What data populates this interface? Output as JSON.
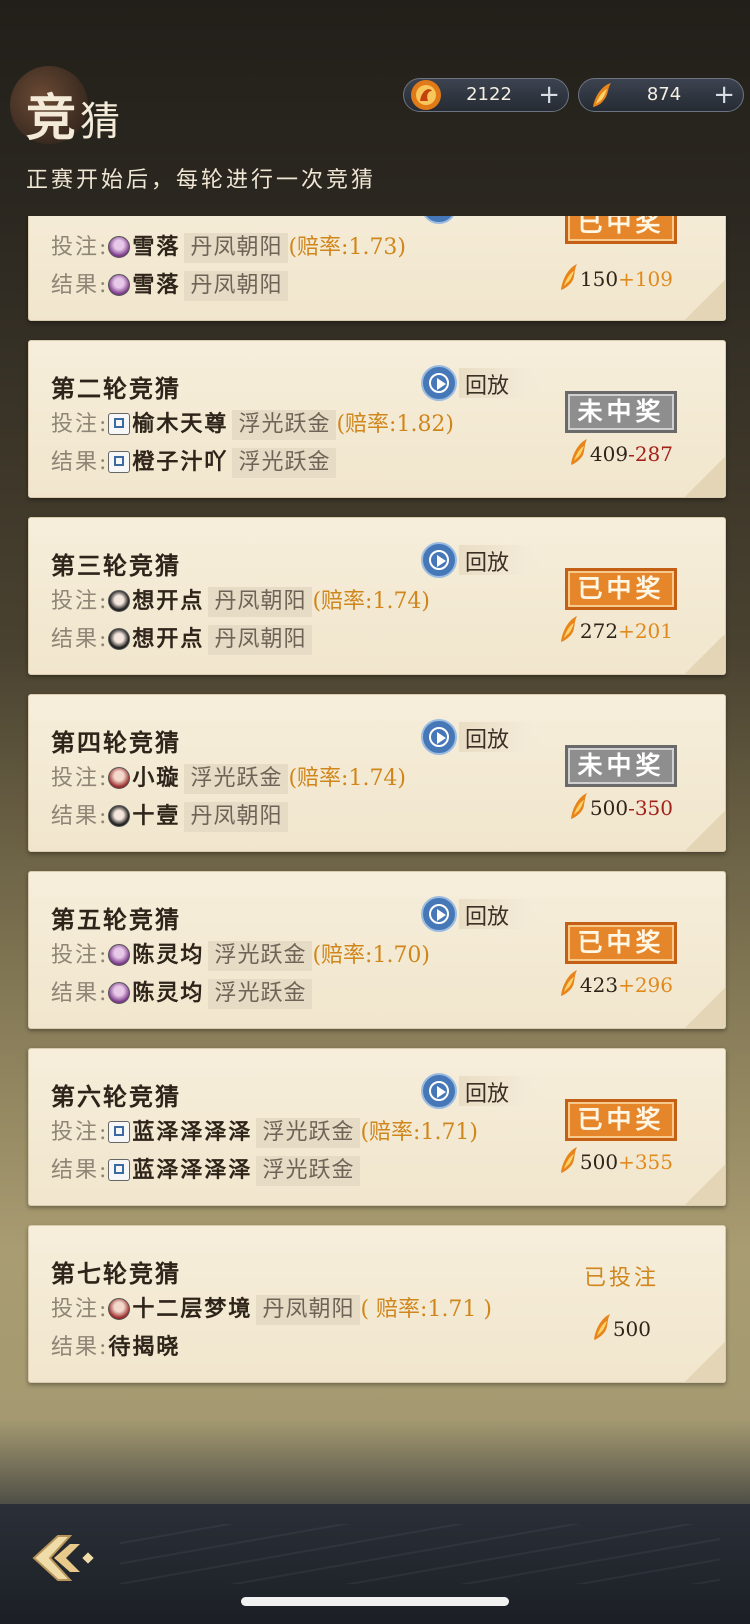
{
  "header": {
    "title_main": "竞",
    "title_second": "猜",
    "subtitle": "正赛开始后，每轮进行一次竞猜"
  },
  "currencies": [
    {
      "icon": "fire-phoenix-icon",
      "value": "2122",
      "plus": "+"
    },
    {
      "icon": "flame-feather-icon",
      "value": "874",
      "plus": "+"
    }
  ],
  "labels": {
    "bet": "投注:",
    "result": "结果:",
    "replay": "回放"
  },
  "rounds": [
    {
      "title": "",
      "bet_avatar": "purple",
      "bet_name": "雪落",
      "bet_team": "丹凤朝阳",
      "odds": "(赔率:1.73)",
      "result_avatar": "purple",
      "result_name": "雪落",
      "result_team": "丹凤朝阳",
      "status": "已中奖",
      "stake": "150",
      "delta": "+109",
      "win": true
    },
    {
      "title": "第二轮竞猜",
      "bet_avatar": "mahjong",
      "bet_name": "榆木天尊",
      "bet_team": "浮光跃金",
      "odds": "(赔率:1.82)",
      "result_avatar": "mahjong",
      "result_name": "橙子汁吖",
      "result_team": "浮光跃金",
      "status": "未中奖",
      "stake": "409",
      "delta": "-287",
      "win": false
    },
    {
      "title": "第三轮竞猜",
      "bet_avatar": "dark",
      "bet_name": "想开点",
      "bet_team": "丹凤朝阳",
      "odds": "(赔率:1.74)",
      "result_avatar": "dark",
      "result_name": "想开点",
      "result_team": "丹凤朝阳",
      "status": "已中奖",
      "stake": "272",
      "delta": "+201",
      "win": true
    },
    {
      "title": "第四轮竞猜",
      "bet_avatar": "red",
      "bet_name": "小璇",
      "bet_team": "浮光跃金",
      "odds": "(赔率:1.74)",
      "result_avatar": "dark",
      "result_name": "十壹",
      "result_team": "丹凤朝阳",
      "status": "未中奖",
      "stake": "500",
      "delta": "-350",
      "win": false
    },
    {
      "title": "第五轮竞猜",
      "bet_avatar": "purple",
      "bet_name": "陈灵均",
      "bet_team": "浮光跃金",
      "odds": "(赔率:1.70)",
      "result_avatar": "purple",
      "result_name": "陈灵均",
      "result_team": "浮光跃金",
      "status": "已中奖",
      "stake": "423",
      "delta": "+296",
      "win": true
    },
    {
      "title": "第六轮竞猜",
      "bet_avatar": "mahjong",
      "bet_name": "蓝泽泽泽泽",
      "bet_team": "浮光跃金",
      "odds": "(赔率:1.71)",
      "result_avatar": "mahjong",
      "result_name": "蓝泽泽泽泽",
      "result_team": "浮光跃金",
      "status": "已中奖",
      "stake": "500",
      "delta": "+355",
      "win": true
    }
  ],
  "pending_round": {
    "title": "第七轮竞猜",
    "bet_name": "十二层梦境",
    "bet_team": "丹凤朝阳",
    "odds": "( 赔率:1.71 )",
    "result_text": "待揭晓",
    "status": "已投注",
    "stake": "500"
  },
  "colors": {
    "win_badge": "#e6862b",
    "lose_badge": "#8e8e8e",
    "gain_text": "#e08a1e",
    "loss_text": "#a2211b",
    "odds_text": "#d0861c",
    "replay_blue": "#4678b8"
  },
  "footer": {
    "back_icon": "back-arrow-icon"
  }
}
